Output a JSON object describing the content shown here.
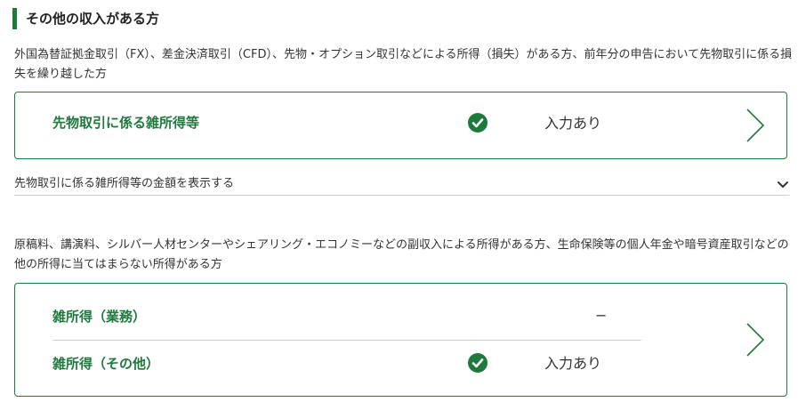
{
  "section": {
    "title": "その他の収入がある方"
  },
  "group1": {
    "description": "外国為替証拠金取引（FX）、差金決済取引（CFD）、先物・オプション取引などによる所得（損失）がある方、前年分の申告において先物取引に係る損失を繰り越した方",
    "card": {
      "label": "先物取引に係る雑所得等",
      "status": "入力あり",
      "status_icon": "check-circle-icon",
      "nav_icon": "chevron-right-icon"
    },
    "toggle": {
      "label": "先物取引に係る雑所得等の金額を表示する",
      "icon": "chevron-down-icon"
    }
  },
  "group2": {
    "description": "原稿料、講演料、シルバー人材センターやシェアリング・エコノミーなどの副収入による所得がある方、生命保険等の個人年金や暗号資産取引などの他の所得に当てはまらない所得がある方",
    "card": {
      "rows": [
        {
          "label": "雑所得（業務）",
          "status": "−"
        },
        {
          "label": "雑所得（その他）",
          "status": "入力あり",
          "status_icon": "check-circle-icon"
        }
      ],
      "nav_icon": "chevron-right-icon"
    }
  },
  "colors": {
    "accent": "#1e7a3c",
    "text": "#333333",
    "divider": "#cccccc"
  }
}
